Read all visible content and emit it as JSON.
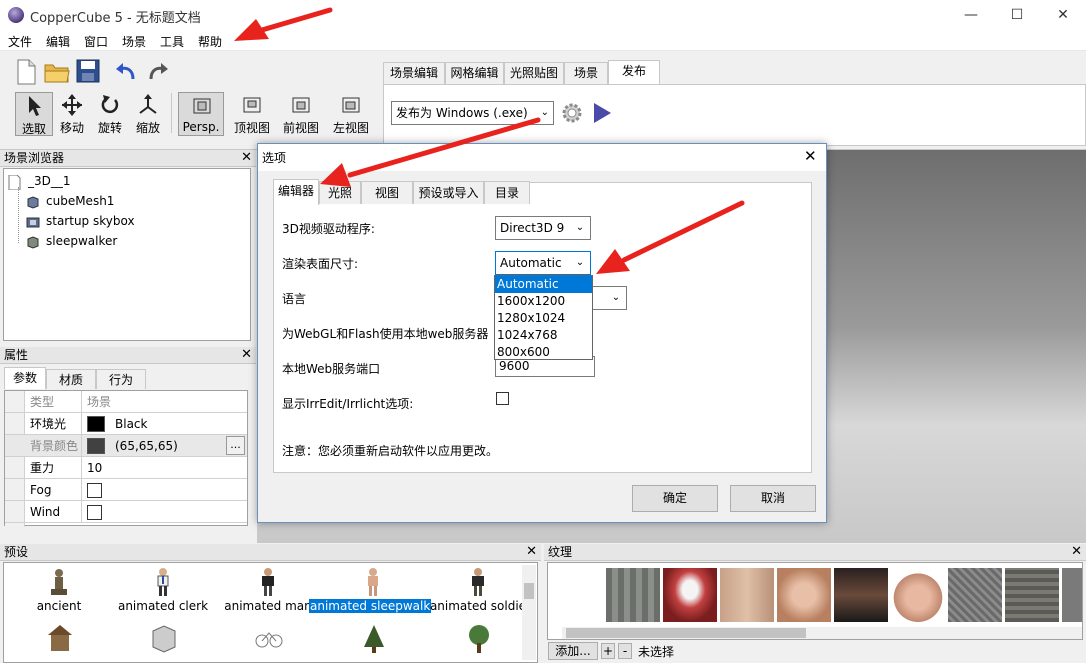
{
  "window": {
    "title": "CopperCube 5 - 无标题文档",
    "minimize": "—",
    "maximize": "☐",
    "close": "✕"
  },
  "menubar": {
    "items": [
      "文件",
      "编辑",
      "窗口",
      "场景",
      "工具",
      "帮助"
    ]
  },
  "toolbar": {
    "tools": [
      {
        "label": "选取",
        "icon": "pointer-icon"
      },
      {
        "label": "移动",
        "icon": "move-icon"
      },
      {
        "label": "旋转",
        "icon": "rotate-icon"
      },
      {
        "label": "缩放",
        "icon": "scale-icon"
      }
    ],
    "views": [
      {
        "label": "Persp.",
        "icon": "perspective-icon"
      },
      {
        "label": "顶视图",
        "icon": "top-view-icon"
      },
      {
        "label": "前视图",
        "icon": "front-view-icon"
      },
      {
        "label": "左视图",
        "icon": "left-view-icon"
      }
    ]
  },
  "editor_tabs": [
    "场景编辑",
    "网格编辑",
    "光照贴图",
    "场景",
    "发布"
  ],
  "publish": {
    "target": "发布为 Windows (.exe)"
  },
  "scene_browser": {
    "title": "场景浏览器",
    "items": [
      "_3D__1",
      "cubeMesh1",
      "startup skybox",
      "sleepwalker"
    ]
  },
  "properties": {
    "title": "属性",
    "tabs": [
      "参数",
      "材质",
      "行为"
    ],
    "rows": [
      {
        "key": "类型",
        "value": "场景"
      },
      {
        "key": "环境光",
        "value": "Black"
      },
      {
        "key": "背景颜色",
        "value": "(65,65,65)"
      },
      {
        "key": "重力",
        "value": "10"
      },
      {
        "key": "Fog",
        "value": ""
      },
      {
        "key": "Wind",
        "value": ""
      }
    ],
    "ellipsis": "..."
  },
  "presets": {
    "title": "预设",
    "items": [
      "ancient",
      "animated clerk",
      "animated man",
      "animated sleepwalk",
      "animated soldie"
    ]
  },
  "textures": {
    "title": "纹理",
    "add_label": "添加...",
    "plus": "+",
    "minus": "-",
    "status": "未选择"
  },
  "dialog": {
    "title": "选项",
    "tabs": [
      "编辑器",
      "光照",
      "视图",
      "预设或导入",
      "目录"
    ],
    "fields": {
      "driver_label": "3D视频驱动程序:",
      "driver_value": "Direct3D 9",
      "surface_label": "渲染表面尺寸:",
      "surface_value": "Automatic",
      "language_label": "语言",
      "webgl_label": "为WebGL和Flash使用本地web服务器",
      "port_label": "本地Web服务端口",
      "port_value": "9600",
      "irredit_label": "显示IrrEdit/Irrlicht选项:"
    },
    "note": "注意：您必须重新启动软件以应用更改。",
    "ok": "确定",
    "cancel": "取消",
    "dropdown_options": [
      "Automatic",
      "1600x1200",
      "1280x1024",
      "1024x768",
      "800x600"
    ]
  },
  "colors": {
    "accent": "#0078d7",
    "annotation_arrow": "#e8231e"
  }
}
